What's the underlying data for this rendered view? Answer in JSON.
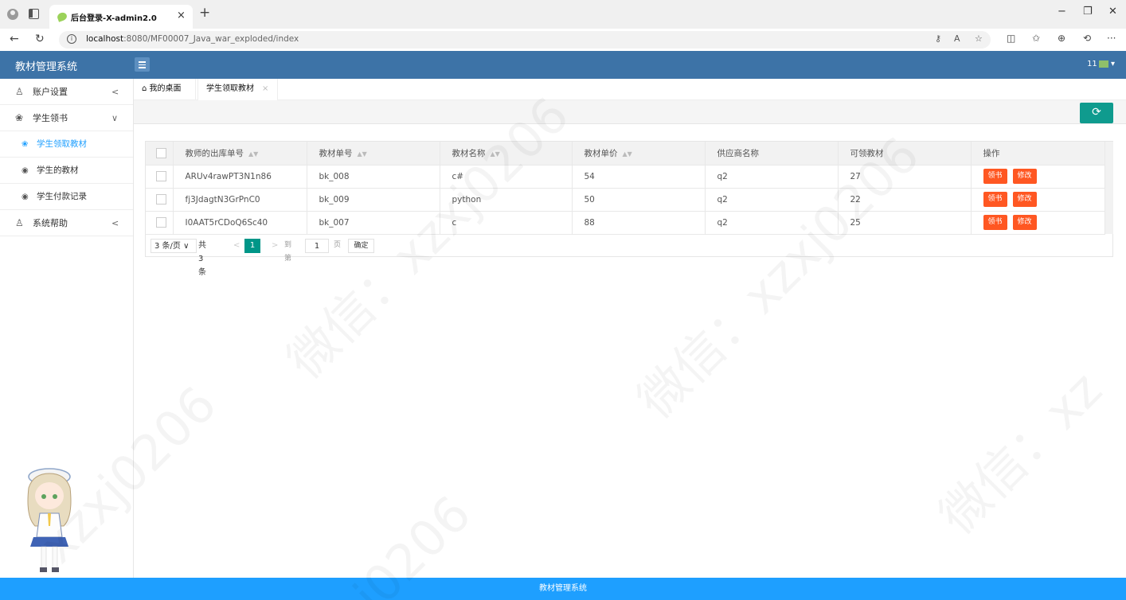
{
  "browser": {
    "tab_title": "后台登录-X-admin2.0",
    "tab_close": "×",
    "new_tab": "+",
    "url_host": "localhost",
    "url_rest": ":8080/MF00007_Java_war_exploded/index",
    "window_controls": [
      "−",
      "❐",
      "✕"
    ],
    "nav": [
      "←",
      "↻"
    ],
    "toolbar_icons": [
      "⚷",
      "A",
      "☆",
      "◫",
      "✩",
      "⊕",
      "⟲",
      "···"
    ]
  },
  "header": {
    "app_title": "教材管理系统",
    "user": "11"
  },
  "sidebar": {
    "items": [
      {
        "icon": "♙",
        "label": "账户设置",
        "arrow": "<"
      },
      {
        "icon": "❀",
        "label": "学生领书",
        "arrow": "∨"
      },
      {
        "icon": "❀",
        "label": "学生领取教材",
        "sub": true,
        "active": true
      },
      {
        "icon": "◉",
        "label": "学生的教材",
        "sub": true
      },
      {
        "icon": "◉",
        "label": "学生付款记录",
        "sub": true
      },
      {
        "icon": "♙",
        "label": "系统帮助",
        "arrow": "<"
      }
    ]
  },
  "tabs": {
    "home": "我的桌面",
    "current": "学生领取教材",
    "close": "×"
  },
  "table": {
    "headers": [
      "教师的出库单号",
      "教材单号",
      "教材名称",
      "教材单价",
      "供应商名称",
      "可领教材",
      "操作"
    ],
    "sortable": [
      true,
      true,
      true,
      true,
      false,
      false,
      false
    ],
    "rows": [
      [
        "ARUv4rawPT3N1n86",
        "bk_008",
        "c#",
        "54",
        "q2",
        "27"
      ],
      [
        "fj3JdagtN3GrPnC0",
        "bk_009",
        "python",
        "50",
        "q2",
        "22"
      ],
      [
        "I0AAT5rCDoQ6Sc40",
        "bk_007",
        "c",
        "88",
        "q2",
        "25"
      ]
    ],
    "actions": [
      "领书",
      "修改"
    ]
  },
  "pager": {
    "limit": "3 条/页",
    "count": "共 3 条",
    "prev": "<",
    "page": "1",
    "next": ">",
    "goto": "到第",
    "page_input": "1",
    "page_unit": "页",
    "confirm": "确定"
  },
  "footer": "教材管理系统",
  "colors": {
    "header": "#3d73a7",
    "footer": "#1e9fff",
    "action_btn": "#ff5722",
    "refresh_btn": "#0f9b8e",
    "active_page": "#009688"
  }
}
